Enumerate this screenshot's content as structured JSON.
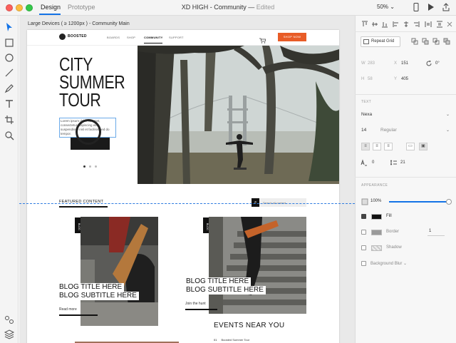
{
  "titlebar": {
    "tabs": [
      "Design",
      "Prototype"
    ],
    "document_title": "XD HIGH - Community",
    "edited_label": "Edited",
    "zoom": "50%"
  },
  "canvas": {
    "artboard_label": "Large Devices ( ≥ 1200px ) - Community Main",
    "site": {
      "logo": "BOOSTED",
      "nav": [
        "BOARDS",
        "SHOP",
        "COMMUNITY",
        "SUPPORT"
      ],
      "shop_button": "SHOP NOW",
      "hero_title": "CITY SUMMER TOUR",
      "hero_body": "Lorem ipsum dolor sit amet, consectetur adipiscing elit, suspendisse nisl et facilisis sed do tempor.",
      "featured_label": "FEATURED CONTENT",
      "search_placeholder": "Search all content",
      "blogs": [
        {
          "tag": "BLOG",
          "title": "BLOG TITLE HERE",
          "subtitle": "BLOG SUBTITLE HERE",
          "link": "Read more"
        },
        {
          "tag": "BLOG",
          "title": "BLOG TITLE HERE",
          "subtitle": "BLOG SUBTITLE HERE",
          "link": "Join the hunt"
        }
      ],
      "events_title": "EVENTS NEAR YOU",
      "event_rows": [
        {
          "num": "01",
          "name": "Boosted Summer Tour"
        }
      ]
    }
  },
  "panel": {
    "repeat_grid": "Repeat Grid",
    "w_label": "W",
    "w_value": "283",
    "x_label": "X",
    "x_value": "151",
    "rotation": "0°",
    "h_label": "H",
    "h_value": "58",
    "y_label": "Y",
    "y_value": "405",
    "text_section": "TEXT",
    "font_family": "Nexa",
    "font_size": "14",
    "font_weight": "Regular",
    "char_spacing": "0",
    "line_spacing": "21",
    "appearance_section": "APPEARANCE",
    "opacity": "100%",
    "opacity_level": 1.0,
    "fill_label": "Fill",
    "fill_color": "#111111",
    "border_label": "Border",
    "border_width": "1",
    "shadow_label": "Shadow",
    "background_blur_label": "Background Blur"
  },
  "colors": {
    "accent": "#1473e6",
    "shop_button": "#e85c27"
  }
}
